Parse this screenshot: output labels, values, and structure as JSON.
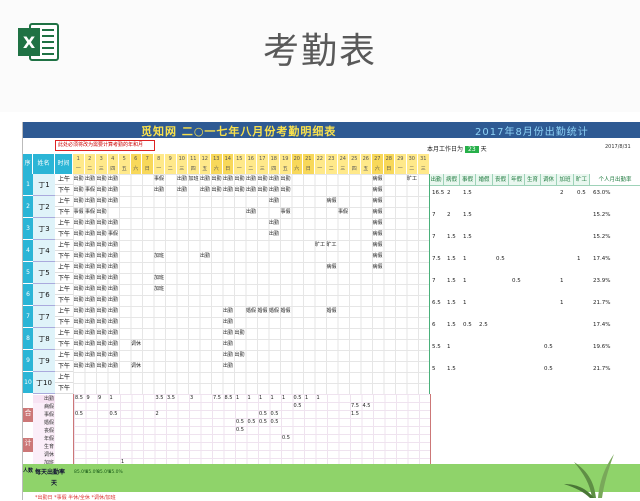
{
  "page": {
    "title": "考勤表"
  },
  "sheet": {
    "left_title": "觅知网 二○一七年八月份考勤明细表",
    "right_title": "2017年8月份出勤统计",
    "note": "此处必须将改为需要计算考勤的年和月",
    "workdays_label": "本月工作日为",
    "workdays_value": "23",
    "workdays_unit": "天",
    "stat_date": "2017/8/31"
  },
  "header": {
    "no": "序号",
    "name": "姓名",
    "time": "时间",
    "days": [
      "一",
      "二",
      "三",
      "四",
      "五",
      "六",
      "日",
      "一",
      "二",
      "三",
      "四",
      "五",
      "六",
      "日",
      "一",
      "二",
      "三",
      "四",
      "五",
      "六",
      "日",
      "一",
      "二",
      "三",
      "四",
      "五",
      "六",
      "日",
      "一",
      "二",
      "三"
    ],
    "sum_cols": [
      "出勤",
      "病假",
      "事假",
      "婚假",
      "丧假",
      "年假",
      "生育",
      "调休",
      "加班",
      "旷工",
      "个人月出勤率"
    ]
  },
  "halves": [
    "上午",
    "下午"
  ],
  "employees": [
    {
      "no": "1",
      "name": "丁1",
      "am": [
        "出勤",
        "出勤",
        "出勤",
        "出勤",
        "",
        "",
        "",
        "事假",
        "",
        "出勤",
        "加班",
        "出勤",
        "出勤",
        "出勤",
        "出勤",
        "出勤",
        "出勤",
        "出勤",
        "出勤",
        "",
        "",
        "",
        "",
        "",
        "",
        "",
        "病假",
        "",
        "",
        "旷工",
        ""
      ],
      "pm": [
        "出勤",
        "事假",
        "出勤",
        "出勤",
        "",
        "",
        "",
        "出勤",
        "",
        "出勤",
        "",
        "出勤",
        "出勤",
        "出勤",
        "出勤",
        "出勤",
        "出勤",
        "出勤",
        "出勤",
        "",
        "",
        "",
        "",
        "",
        "",
        "",
        "病假",
        "",
        "",
        "",
        ""
      ],
      "sum": [
        "16.5",
        "2",
        "1.5",
        "",
        "",
        "",
        "",
        "",
        "2",
        "0.5",
        "63.0%"
      ]
    },
    {
      "no": "2",
      "name": "丁2",
      "am": [
        "出勤",
        "出勤",
        "出勤",
        "出勤",
        "",
        "",
        "",
        "",
        "",
        "",
        "",
        "",
        "",
        "",
        "",
        "",
        "",
        "出勤",
        "",
        "",
        "",
        "",
        "病假",
        "",
        "",
        "",
        "病假",
        "",
        "",
        "",
        ""
      ],
      "pm": [
        "事假",
        "事假",
        "出勤",
        "",
        "",
        "",
        "",
        "",
        "",
        "",
        "",
        "",
        "",
        "",
        "",
        "出勤",
        "",
        "",
        "事假",
        "",
        "",
        "",
        "",
        "事假",
        "",
        "",
        "病假",
        "",
        "",
        "",
        ""
      ],
      "sum": [
        "7",
        "2",
        "1.5",
        "",
        "",
        "",
        "",
        "",
        "",
        "",
        "15.2%"
      ]
    },
    {
      "no": "3",
      "name": "丁3",
      "am": [
        "出勤",
        "出勤",
        "出勤",
        "出勤",
        "",
        "",
        "",
        "",
        "",
        "",
        "",
        "",
        "",
        "",
        "",
        "",
        "",
        "出勤",
        "",
        "",
        "",
        "",
        "",
        "",
        "",
        "",
        "病假",
        "",
        "",
        "",
        ""
      ],
      "pm": [
        "出勤",
        "出勤",
        "出勤",
        "事假",
        "",
        "",
        "",
        "",
        "",
        "",
        "",
        "",
        "",
        "",
        "",
        "",
        "",
        "出勤",
        "",
        "",
        "",
        "",
        "",
        "",
        "",
        "",
        "病假",
        "",
        "",
        "",
        ""
      ],
      "sum": [
        "7",
        "1.5",
        "1.5",
        "",
        "",
        "",
        "",
        "",
        "",
        "",
        "15.2%"
      ]
    },
    {
      "no": "4",
      "name": "丁4",
      "am": [
        "出勤",
        "出勤",
        "出勤",
        "出勤",
        "",
        "",
        "",
        "",
        "",
        "",
        "",
        "",
        "",
        "",
        "",
        "",
        "",
        "",
        "",
        "",
        "",
        "旷工",
        "旷工",
        "",
        "",
        "",
        "病假",
        "",
        "",
        "",
        ""
      ],
      "pm": [
        "出勤",
        "出勤",
        "出勤",
        "出勤",
        "",
        "",
        "",
        "加班",
        "",
        "",
        "",
        "出勤",
        "",
        "",
        "",
        "",
        "",
        "",
        "",
        "",
        "",
        "",
        "",
        "",
        "",
        "",
        "病假",
        "",
        "",
        "",
        ""
      ],
      "sum": [
        "7.5",
        "1.5",
        "1",
        "",
        "0.5",
        "",
        "",
        "",
        "",
        "1",
        "17.4%"
      ]
    },
    {
      "no": "5",
      "name": "丁5",
      "am": [
        "出勤",
        "出勤",
        "出勤",
        "出勤",
        "",
        "",
        "",
        "",
        "",
        "",
        "",
        "",
        "",
        "",
        "",
        "",
        "",
        "",
        "",
        "",
        "",
        "",
        "病假",
        "",
        "",
        "",
        "病假",
        "",
        "",
        "",
        ""
      ],
      "pm": [
        "出勤",
        "出勤",
        "出勤",
        "出勤",
        "",
        "",
        "",
        "加班",
        "",
        "",
        "",
        "",
        "",
        "",
        "",
        "",
        "",
        "",
        "",
        "",
        "",
        "",
        "",
        "",
        "",
        "",
        "",
        "",
        "",
        "",
        ""
      ],
      "sum": [
        "7",
        "1.5",
        "1",
        "",
        "",
        "0.5",
        "",
        "",
        "1",
        "",
        "23.9%"
      ]
    },
    {
      "no": "6",
      "name": "丁6",
      "am": [
        "出勤",
        "出勤",
        "出勤",
        "出勤",
        "",
        "",
        "",
        "加班",
        "",
        "",
        "",
        "",
        "",
        "",
        "",
        "",
        "",
        "",
        "",
        "",
        "",
        "",
        "",
        "",
        "",
        "",
        "",
        "",
        "",
        "",
        ""
      ],
      "pm": [
        "出勤",
        "出勤",
        "出勤",
        "出勤",
        "",
        "",
        "",
        "",
        "",
        "",
        "",
        "",
        "",
        "",
        "",
        "",
        "",
        "",
        "",
        "",
        "",
        "",
        "",
        "",
        "",
        "",
        "",
        "",
        "",
        "",
        ""
      ],
      "sum": [
        "6.5",
        "1.5",
        "1",
        "",
        "",
        "",
        "",
        "",
        "1",
        "",
        "21.7%"
      ]
    },
    {
      "no": "7",
      "name": "丁7",
      "am": [
        "出勤",
        "出勤",
        "出勤",
        "出勤",
        "",
        "",
        "",
        "",
        "",
        "",
        "",
        "",
        "",
        "出勤",
        "",
        "婚假",
        "婚假",
        "婚假",
        "婚假",
        "",
        "",
        "",
        "婚假",
        "",
        "",
        "",
        "",
        "",
        "",
        "",
        ""
      ],
      "pm": [
        "出勤",
        "出勤",
        "出勤",
        "出勤",
        "",
        "",
        "",
        "",
        "",
        "",
        "",
        "",
        "",
        "出勤",
        "",
        "",
        "",
        "",
        "",
        "",
        "",
        "",
        "",
        "",
        "",
        "",
        "",
        "",
        "",
        "",
        ""
      ],
      "sum": [
        "6",
        "1.5",
        "0.5",
        "2.5",
        "",
        "",
        "",
        "",
        "",
        "",
        "17.4%"
      ]
    },
    {
      "no": "8",
      "name": "丁8",
      "am": [
        "出勤",
        "出勤",
        "出勤",
        "出勤",
        "",
        "",
        "",
        "",
        "",
        "",
        "",
        "",
        "",
        "出勤",
        "出勤",
        "",
        "",
        "",
        "",
        "",
        "",
        "",
        "",
        "",
        "",
        "",
        "",
        "",
        "",
        "",
        ""
      ],
      "pm": [
        "出勤",
        "出勤",
        "出勤",
        "出勤",
        "",
        "调休",
        "",
        "",
        "",
        "",
        "",
        "",
        "",
        "出勤",
        "",
        "",
        "",
        "",
        "",
        "",
        "",
        "",
        "",
        "",
        "",
        "",
        "",
        "",
        "",
        "",
        ""
      ],
      "sum": [
        "5.5",
        "1",
        "",
        "",
        "",
        "",
        "",
        "0.5",
        "",
        "",
        "19.6%"
      ]
    },
    {
      "no": "9",
      "name": "丁9",
      "am": [
        "出勤",
        "出勤",
        "出勤",
        "出勤",
        "",
        "",
        "",
        "",
        "",
        "",
        "",
        "",
        "",
        "出勤",
        "出勤",
        "",
        "",
        "",
        "",
        "",
        "",
        "",
        "",
        "",
        "",
        "",
        "",
        "",
        "",
        "",
        ""
      ],
      "pm": [
        "出勤",
        "出勤",
        "出勤",
        "出勤",
        "",
        "调休",
        "",
        "",
        "",
        "",
        "",
        "",
        "",
        "出勤",
        "",
        "",
        "",
        "",
        "",
        "",
        "",
        "",
        "",
        "",
        "",
        "",
        "",
        "",
        "",
        "",
        ""
      ],
      "sum": [
        "5",
        "1.5",
        "",
        "",
        "",
        "",
        "",
        "0.5",
        "",
        "",
        "21.7%"
      ]
    },
    {
      "no": "10",
      "name": "丁10",
      "am": [],
      "pm": [],
      "sum": []
    }
  ],
  "bottom": {
    "side_labels": [
      "合",
      "计"
    ],
    "types": [
      "出勤",
      "病假",
      "事假",
      "婚假",
      "丧假",
      "年假",
      "生育",
      "调休",
      "加班"
    ],
    "rows": [
      [
        "8.5",
        "9",
        "9",
        "1",
        "",
        "",
        "",
        "3.5",
        "3.5",
        "",
        "3",
        "",
        "7.5",
        "8.5",
        "1",
        "1",
        "1",
        "1",
        "1",
        "0.5",
        "1",
        "1",
        ""
      ],
      [
        "",
        "",
        "",
        "",
        "",
        "",
        "",
        "",
        "",
        "",
        "",
        "",
        "",
        "",
        "",
        "",
        "",
        "",
        "",
        "0.5",
        "",
        "",
        "",
        "",
        "7.5",
        "4.5"
      ],
      [
        "0.5",
        "",
        "",
        "0.5",
        "",
        "",
        "",
        "2",
        "",
        "",
        "",
        "",
        "",
        "",
        "",
        "",
        "0.5",
        "0.5",
        "",
        "",
        "",
        "",
        "",
        "",
        "1.5"
      ],
      [
        "",
        "",
        "",
        "",
        "",
        "",
        "",
        "",
        "",
        "",
        "",
        "",
        "",
        "",
        "0.5",
        "0.5",
        "0.5",
        "0.5"
      ],
      [
        "",
        "",
        "",
        "",
        "",
        "",
        "",
        "",
        "",
        "",
        "",
        "",
        "",
        "",
        "0.5"
      ],
      [
        "",
        "",
        "",
        "",
        "",
        "",
        "",
        "",
        "",
        "",
        "",
        "",
        "",
        "",
        "",
        "",
        "",
        "",
        "0.5"
      ],
      [
        "",
        "",
        "",
        "",
        "",
        "",
        "",
        "",
        "",
        "",
        "",
        "",
        "",
        "",
        "",
        "",
        "",
        "",
        "",
        "",
        "",
        "",
        "",
        "",
        "",
        ""
      ],
      [
        "",
        "",
        "",
        "",
        "",
        "",
        "",
        "",
        "",
        "",
        "",
        "",
        "",
        "",
        "",
        "",
        "",
        "",
        "",
        "",
        "",
        "",
        "",
        "",
        "",
        ""
      ],
      [
        "",
        "",
        "",
        "",
        "1",
        "",
        "",
        "",
        "",
        "",
        "",
        ""
      ]
    ],
    "people_rows": [
      {
        "label": "每天出勤率",
        "side": "人数"
      },
      {
        "label": "天",
        "side": ""
      }
    ],
    "green_values": [
      "85.0%",
      "85.0%",
      "85.0%",
      "85.0%",
      "",
      "",
      "",
      "",
      "",
      "",
      "",
      "",
      "",
      "",
      "",
      "",
      "",
      "",
      "",
      "",
      "",
      "",
      "",
      "",
      "",
      "",
      "",
      "",
      "",
      "",
      ""
    ],
    "footer": "*出勤日  *事假 半休/全休   *调休/加班"
  }
}
